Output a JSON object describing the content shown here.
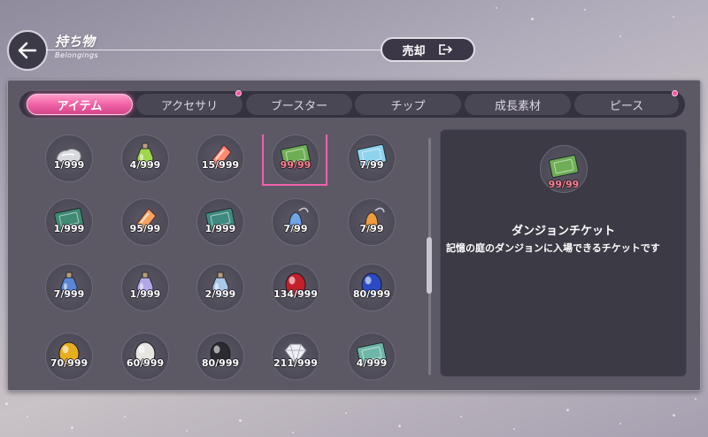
{
  "header": {
    "title": "持ち物",
    "subtitle": "Belongings",
    "sell_label": "売却"
  },
  "tabs": [
    {
      "label": "アイテム",
      "active": true,
      "notice": false
    },
    {
      "label": "アクセサリ",
      "active": false,
      "notice": true
    },
    {
      "label": "ブースター",
      "active": false,
      "notice": false
    },
    {
      "label": "チップ",
      "active": false,
      "notice": false
    },
    {
      "label": "成長素材",
      "active": false,
      "notice": false
    },
    {
      "label": "ピース",
      "active": false,
      "notice": true
    }
  ],
  "items": [
    {
      "icon": "silver-ore-icon",
      "count": "1/999",
      "color": "#d7d9dd"
    },
    {
      "icon": "green-potion-icon",
      "count": "4/999",
      "color": "#9fd64a"
    },
    {
      "icon": "red-crystal-icon",
      "count": "15/999",
      "color": "#ff8a73"
    },
    {
      "icon": "green-ticket-icon",
      "count": "99/99",
      "color": "#6fae55",
      "maxed": true,
      "selected": true
    },
    {
      "icon": "blue-ticket-icon",
      "count": "7/99",
      "color": "#8fd3ef"
    },
    {
      "icon": "dark-green-ticket-icon",
      "count": "1/999",
      "color": "#3e8a72"
    },
    {
      "icon": "orange-crystal-icon",
      "count": "95/99",
      "color": "#f5a35e"
    },
    {
      "icon": "teal-ticket-icon",
      "count": "1/999",
      "color": "#3f8a80"
    },
    {
      "icon": "blue-bell-icon",
      "count": "7/99",
      "color": "#6fa5e6"
    },
    {
      "icon": "orange-bell-icon",
      "count": "7/99",
      "color": "#ef9a3b"
    },
    {
      "icon": "blue-bottle-icon",
      "count": "7/999",
      "color": "#5b86d8"
    },
    {
      "icon": "rainbow-bottle-icon",
      "count": "1/999",
      "color": "#b3a7ea"
    },
    {
      "icon": "light-blue-bottle-icon",
      "count": "2/999",
      "color": "#a9c8ea"
    },
    {
      "icon": "red-gem-icon",
      "count": "134/999",
      "color": "#c3202a"
    },
    {
      "icon": "blue-gem-icon",
      "count": "80/999",
      "color": "#2a4bc4"
    },
    {
      "icon": "yellow-gem-icon",
      "count": "70/999",
      "color": "#e6ad1c"
    },
    {
      "icon": "white-pearl-icon",
      "count": "60/999",
      "color": "#e8e6e1"
    },
    {
      "icon": "black-gem-icon",
      "count": "80/999",
      "color": "#2a2a30"
    },
    {
      "icon": "diamond-icon",
      "count": "211/999",
      "color": "#eef0f4"
    },
    {
      "icon": "teal-plate-icon",
      "count": "4/999",
      "color": "#6fb7a8"
    }
  ],
  "detail": {
    "icon": "green-ticket-icon",
    "count": "99/99",
    "name": "ダンジョンチケット",
    "description": "記憶の庭のダンジョンに入場できるチケットです"
  }
}
